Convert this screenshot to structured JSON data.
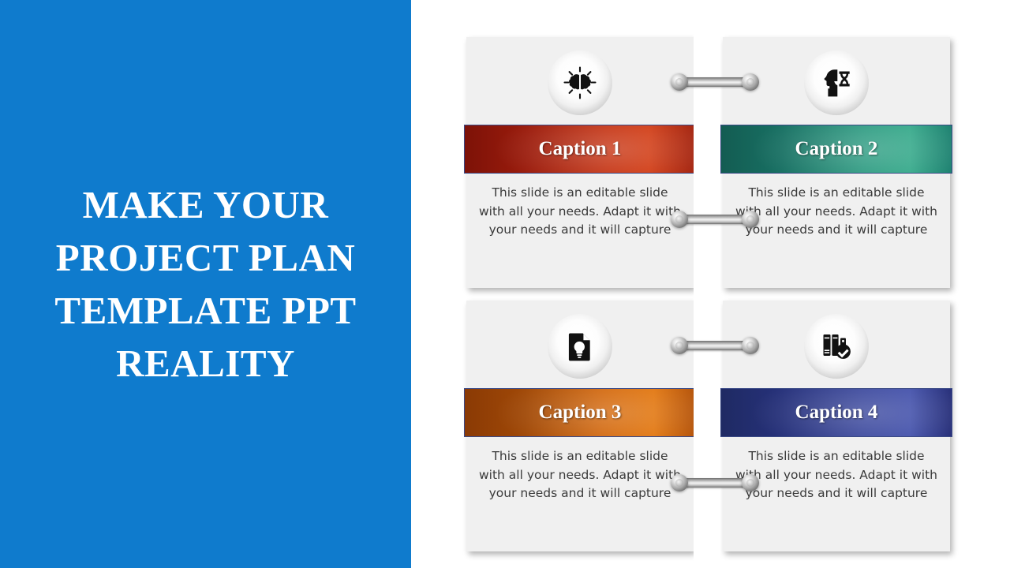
{
  "slide": {
    "background_color": "#ffffff",
    "panel_color": "#0f7bcd"
  },
  "left_panel": {
    "title": "MAKE YOUR PROJECT PLAN TEMPLATE PPT REALITY"
  },
  "cards": [
    {
      "id": "card-1",
      "icon_name": "brain-idea-icon",
      "caption": "Caption 1",
      "caption_color": "#c4300f",
      "body": "This slide is an editable slide with all your needs. Adapt it with your needs and it will capture"
    },
    {
      "id": "card-2",
      "icon_name": "head-hourglass-icon",
      "caption": "Caption 2",
      "caption_color": "#2b9a80",
      "body": "This slide is an editable slide with all your needs. Adapt it with your needs and it will capture"
    },
    {
      "id": "card-3",
      "icon_name": "document-lightbulb-icon",
      "caption": "Caption 3",
      "caption_color": "#d2660a",
      "body": "This slide is an editable slide with all your needs. Adapt it with your needs and it will capture"
    },
    {
      "id": "card-4",
      "icon_name": "books-checkmark-icon",
      "caption": "Caption 4",
      "caption_color": "#39469b",
      "body": "This slide is an editable slide with all your needs. Adapt it with your needs and it will capture"
    }
  ],
  "connectors": [
    {
      "name": "connector-top-horizontal"
    },
    {
      "name": "connector-upper-middle"
    },
    {
      "name": "connector-lower-middle"
    },
    {
      "name": "connector-bottom-horizontal"
    }
  ]
}
